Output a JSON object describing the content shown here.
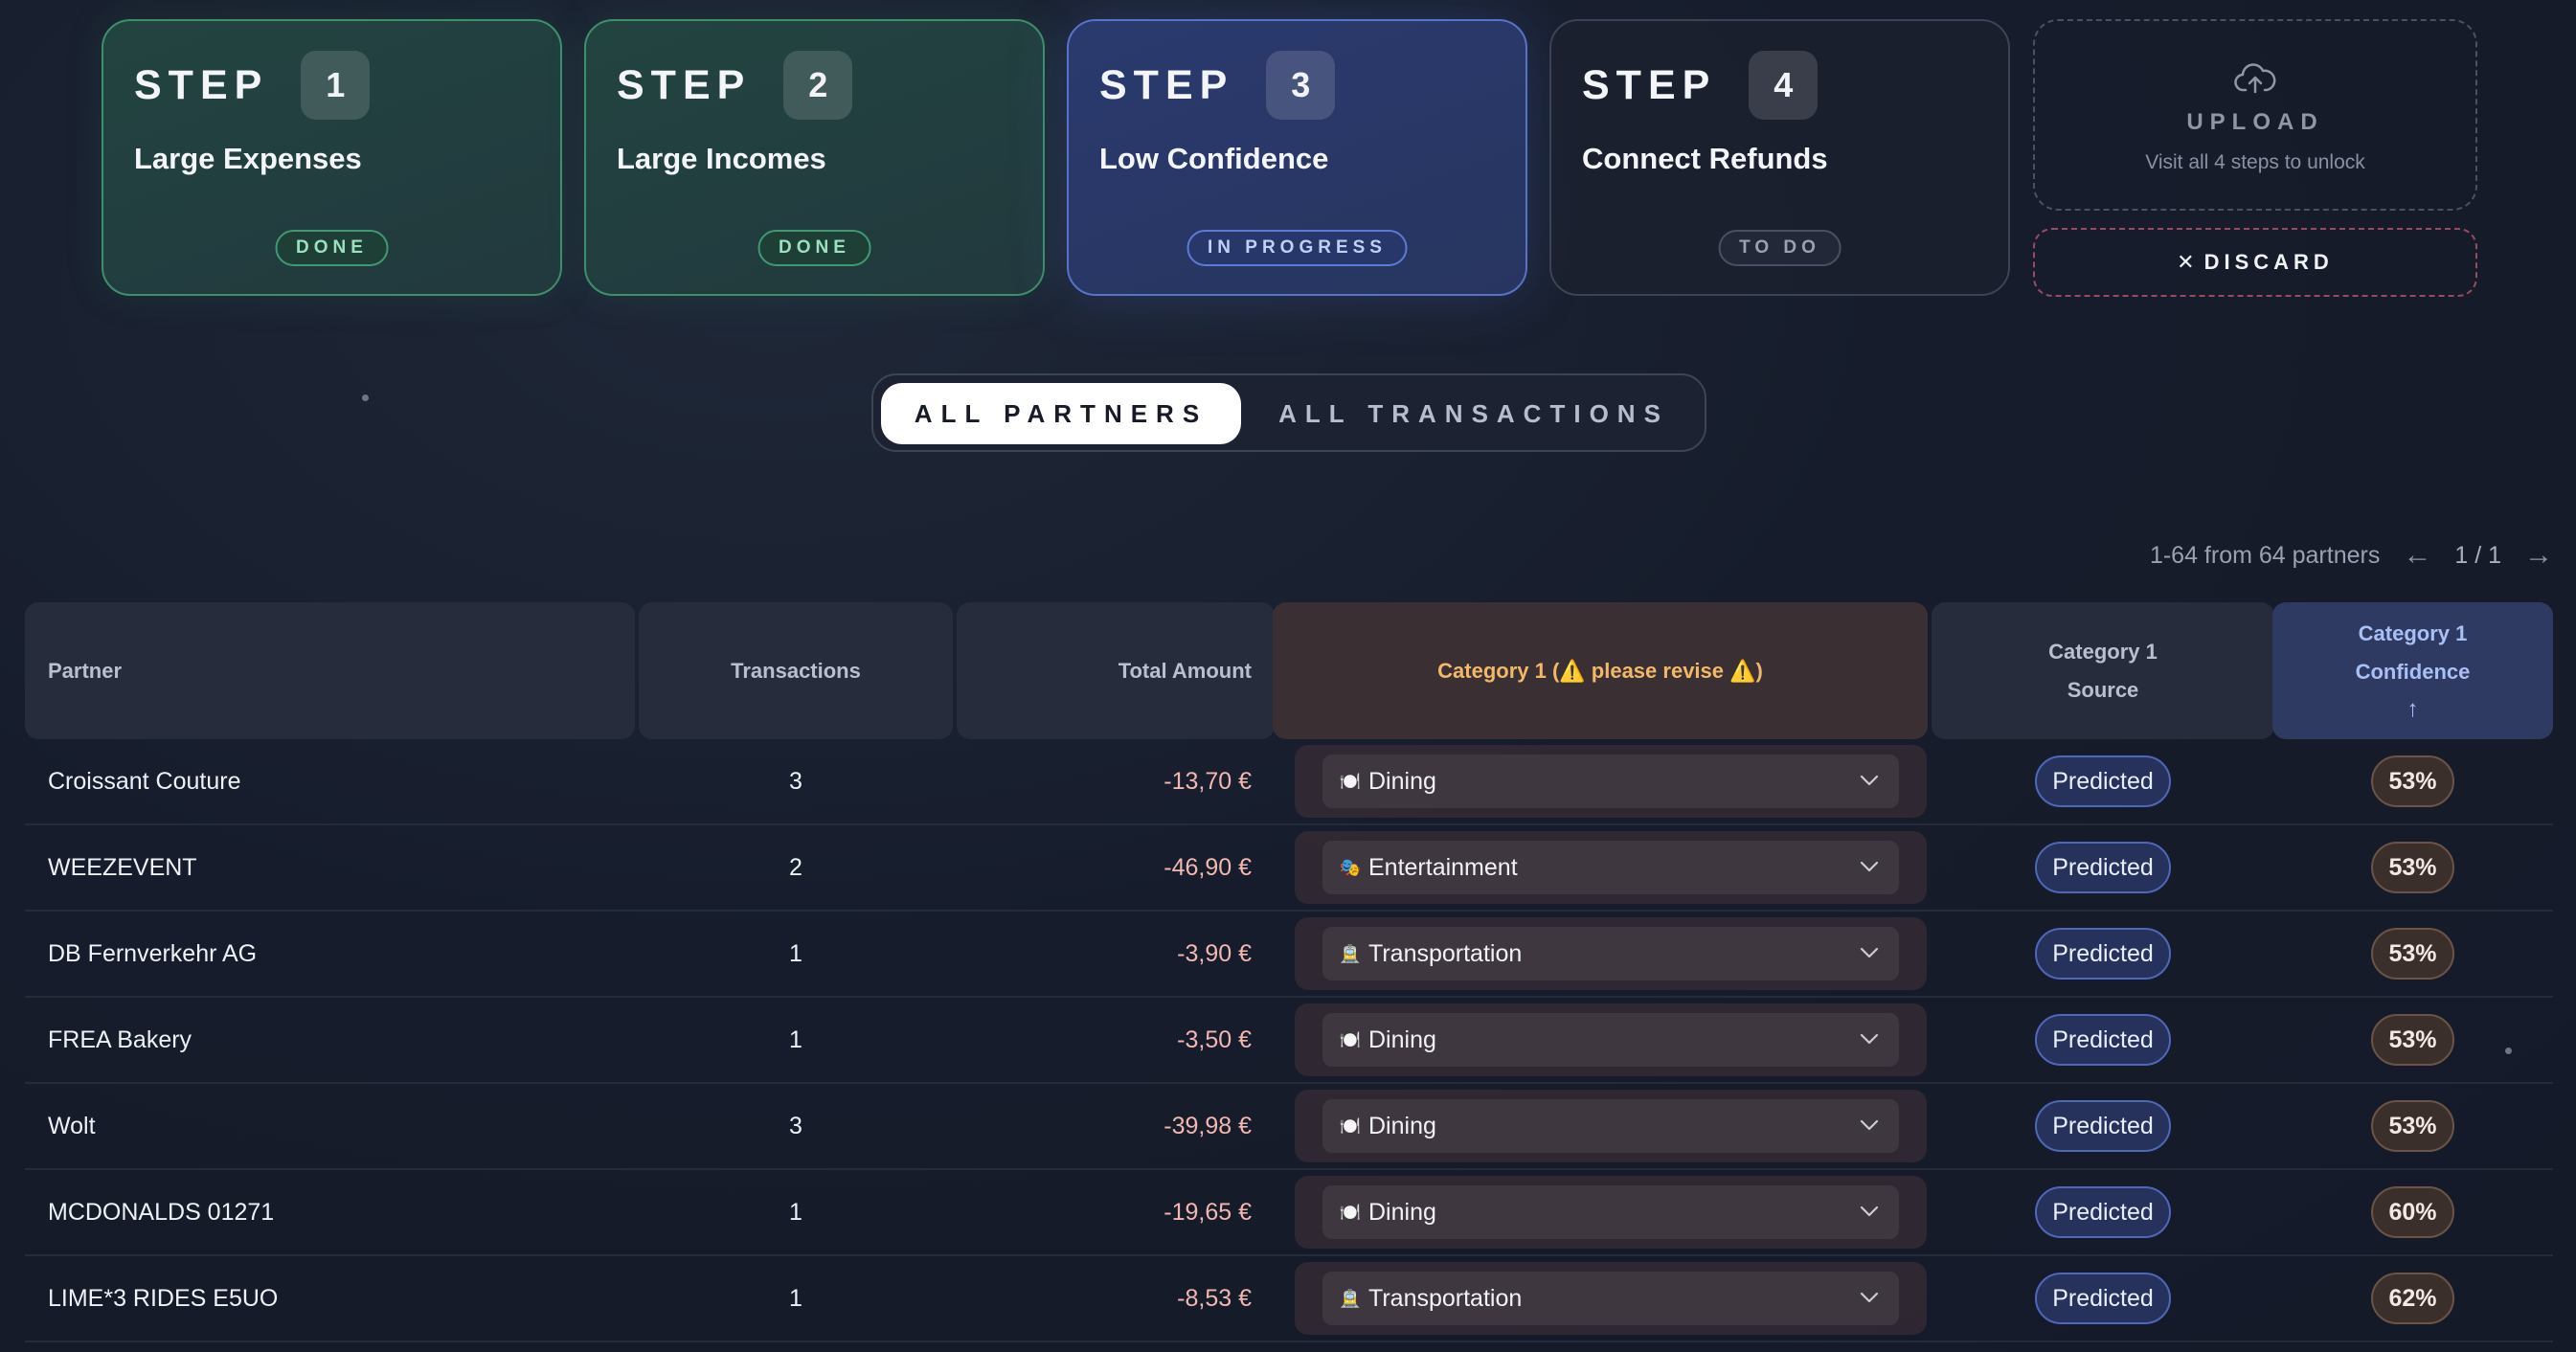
{
  "steps": [
    {
      "word": "STEP",
      "number": "1",
      "title": "Large Expenses",
      "status": "DONE"
    },
    {
      "word": "STEP",
      "number": "2",
      "title": "Large Incomes",
      "status": "DONE"
    },
    {
      "word": "STEP",
      "number": "3",
      "title": "Low Confidence",
      "status": "IN PROGRESS"
    },
    {
      "word": "STEP",
      "number": "4",
      "title": "Connect Refunds",
      "status": "TO DO"
    }
  ],
  "upload": {
    "title": "UPLOAD",
    "subtitle": "Visit all 4 steps to unlock",
    "icon": "cloud-upload-icon"
  },
  "discard": {
    "label": "DISCARD",
    "icon": "close-icon"
  },
  "view_toggle": {
    "active": "ALL PARTNERS",
    "inactive": "ALL TRANSACTIONS"
  },
  "pagination": {
    "summary": "1-64 from 64 partners",
    "pages": "1 / 1"
  },
  "table": {
    "headers": {
      "partner": "Partner",
      "transactions": "Transactions",
      "total_amount": "Total Amount",
      "category": "Category 1 (⚠️ please revise ⚠️)",
      "source_line1": "Category 1",
      "source_line2": "Source",
      "confidence_line1": "Category 1",
      "confidence_line2": "Confidence",
      "confidence_sort": "↑"
    },
    "rows": [
      {
        "partner": "Croissant Couture",
        "transactions": "3",
        "amount": "-13,70 €",
        "category": "Dining",
        "emoji": "🍽️",
        "source": "Predicted",
        "confidence": "53%"
      },
      {
        "partner": "WEEZEVENT",
        "transactions": "2",
        "amount": "-46,90 €",
        "category": "Entertainment",
        "emoji": "🎭",
        "source": "Predicted",
        "confidence": "53%"
      },
      {
        "partner": "DB Fernverkehr AG",
        "transactions": "1",
        "amount": "-3,90 €",
        "category": "Transportation",
        "emoji": "🚊",
        "source": "Predicted",
        "confidence": "53%"
      },
      {
        "partner": "FREA Bakery",
        "transactions": "1",
        "amount": "-3,50 €",
        "category": "Dining",
        "emoji": "🍽️",
        "source": "Predicted",
        "confidence": "53%"
      },
      {
        "partner": "Wolt",
        "transactions": "3",
        "amount": "-39,98 €",
        "category": "Dining",
        "emoji": "🍽️",
        "source": "Predicted",
        "confidence": "53%"
      },
      {
        "partner": "MCDONALDS 01271",
        "transactions": "1",
        "amount": "-19,65 €",
        "category": "Dining",
        "emoji": "🍽️",
        "source": "Predicted",
        "confidence": "60%"
      },
      {
        "partner": "LIME*3 RIDES E5UO",
        "transactions": "1",
        "amount": "-8,53 €",
        "category": "Transportation",
        "emoji": "🚊",
        "source": "Predicted",
        "confidence": "62%"
      }
    ]
  },
  "colors": {
    "done": "#3e8f6a",
    "in_progress": "#5872c8",
    "discard_border": "#9a4a5e",
    "warning_text": "#f2b86a"
  }
}
